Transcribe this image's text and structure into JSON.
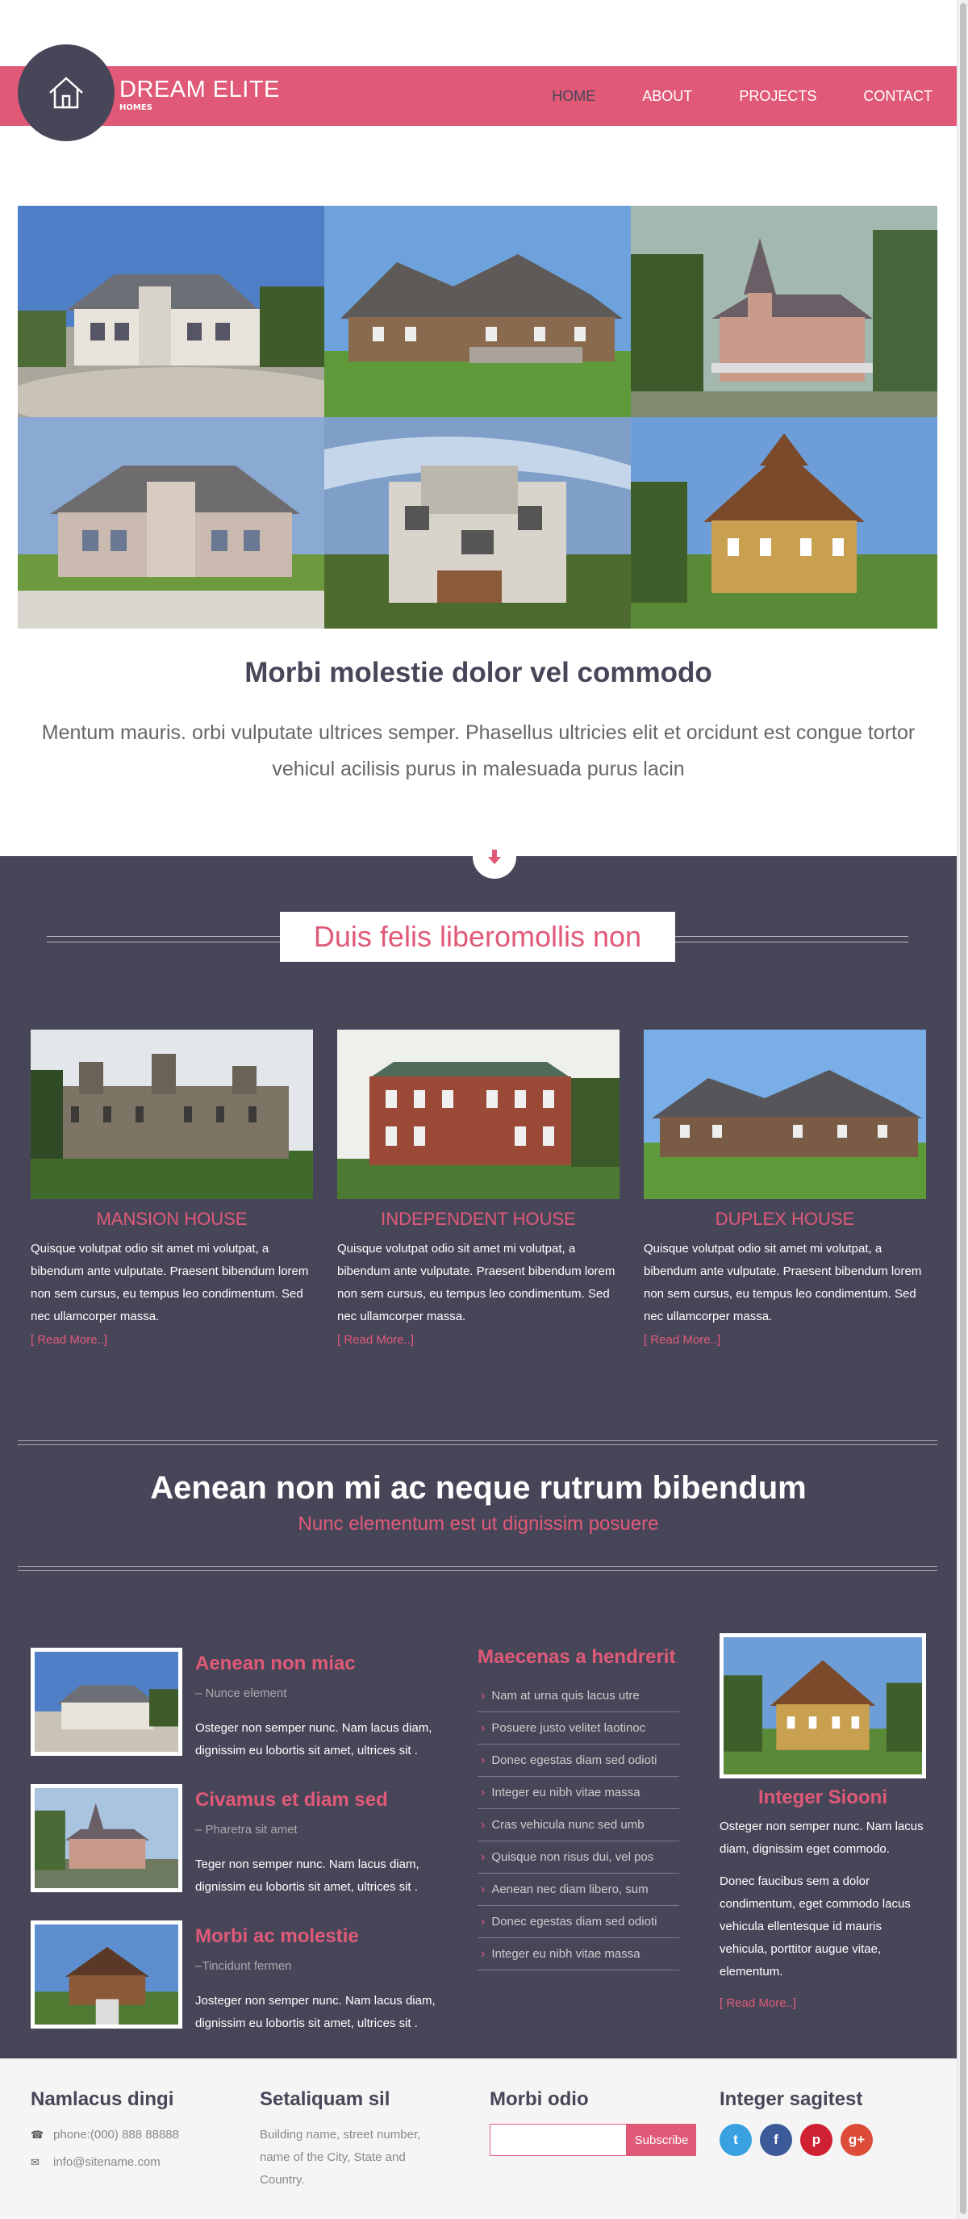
{
  "brand": {
    "title": "DREAM ELITE",
    "subtitle": "HOMES",
    "logo_icon": "home-icon"
  },
  "nav": [
    {
      "label": "HOME",
      "active": true
    },
    {
      "label": "ABOUT",
      "active": false
    },
    {
      "label": "PROJECTS",
      "active": false
    },
    {
      "label": "CONTACT",
      "active": false
    }
  ],
  "intro": {
    "title": "Morbi molestie dolor vel commodo",
    "text": "Mentum mauris. orbi vulputate ultrices semper. Phasellus ultricies elit et orcidunt est congue tortor vehicul acilisis purus in malesuada purus lacin"
  },
  "section": {
    "heading": "Duis felis liberomollis non",
    "down_icon": "arrow-down-icon"
  },
  "cards": [
    {
      "title": "MANSION HOUSE",
      "text": "Quisque volutpat odio sit amet mi volutpat, a bibendum ante vulputate. Praesent bibendum lorem non sem cursus, eu tempus leo condimentum. Sed nec ullamcorper massa.",
      "more": "[ Read More..]"
    },
    {
      "title": "INDEPENDENT HOUSE",
      "text": "Quisque volutpat odio sit amet mi volutpat, a bibendum ante vulputate. Praesent bibendum lorem non sem cursus, eu tempus leo condimentum. Sed nec ullamcorper massa.",
      "more": "[ Read More..]"
    },
    {
      "title": "DUPLEX HOUSE",
      "text": "Quisque volutpat odio sit amet mi volutpat, a bibendum ante vulputate. Praesent bibendum lorem non sem cursus, eu tempus leo condimentum. Sed nec ullamcorper massa.",
      "more": "[ Read More..]"
    }
  ],
  "banner": {
    "title": "Aenean non mi ac neque rutrum bibendum",
    "subtitle": "Nunc elementum est ut dignissim posuere"
  },
  "posts": [
    {
      "title": "Aenean non miac",
      "subtitle": "– Nunce element",
      "text": "Osteger non semper nunc. Nam lacus diam, dignissim eu lobortis sit amet, ultrices sit ."
    },
    {
      "title": "Civamus et diam sed",
      "subtitle": "– Pharetra sit amet",
      "text": "Teger non semper nunc. Nam lacus diam, dignissim eu lobortis sit amet, ultrices sit ."
    },
    {
      "title": "Morbi ac molestie",
      "subtitle": "–Tincidunt fermen",
      "text": "Josteger non semper nunc. Nam lacus diam, dignissim eu lobortis sit amet, ultrices sit ."
    }
  ],
  "links": {
    "title": "Maecenas a hendrerit",
    "items": [
      "Nam at urna quis lacus utre",
      "Posuere justo velitet laotinoc",
      "Donec egestas diam sed odioti",
      "Integer eu nibh vitae massa",
      "Cras vehicula nunc sed umb",
      "Quisque non risus dui, vel pos",
      "Aenean nec diam libero, sum",
      "Donec egestas diam sed odioti",
      "Integer eu nibh vitae massa"
    ]
  },
  "feature": {
    "title": "Integer Siooni",
    "text1": "Osteger non semper nunc. Nam lacus diam, dignissim eget commodo.",
    "text2": "Donec faucibus sem a dolor condimentum, eget commodo lacus vehicula ellentesque id mauris vehicula, porttitor augue vitae, elementum.",
    "more": "[ Read More..]"
  },
  "footer": {
    "col1": {
      "title": "Namlacus dingi",
      "phone": "phone:(000) 888 88888",
      "email": "info@sitename.com"
    },
    "col2": {
      "title": "Setaliquam sil",
      "address": "Building name, street number, name of the City, State and Country."
    },
    "col3": {
      "title": "Morbi odio",
      "placeholder": "",
      "button": "Subscribe"
    },
    "col4": {
      "title": "Integer sagitest",
      "social": [
        {
          "name": "twitter-icon",
          "glyph": "t",
          "color": "#3aa1e0"
        },
        {
          "name": "facebook-icon",
          "glyph": "f",
          "color": "#3b5a9a"
        },
        {
          "name": "pinterest-icon",
          "glyph": "p",
          "color": "#cf2132"
        },
        {
          "name": "google-plus-icon",
          "glyph": "g+",
          "color": "#dd4b39"
        }
      ]
    }
  },
  "colors": {
    "accent": "#e05a78",
    "dark": "#474659"
  }
}
